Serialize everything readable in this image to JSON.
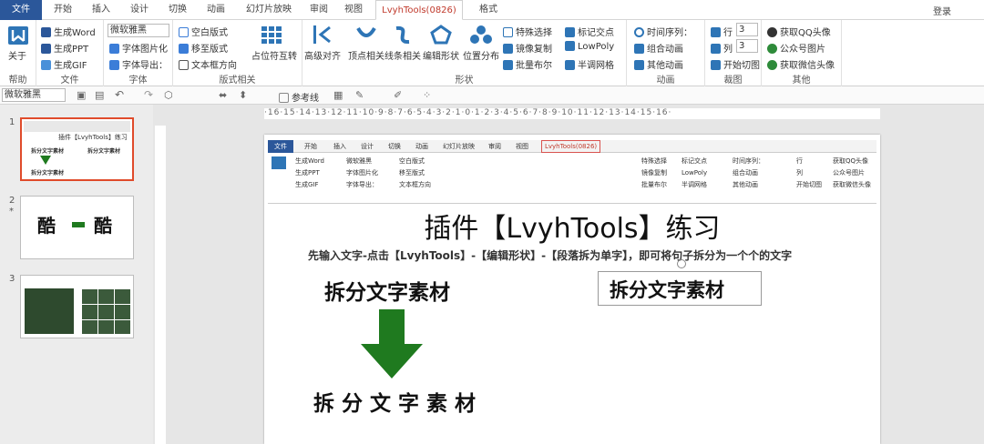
{
  "tabs": [
    "文件",
    "开始",
    "插入",
    "设计",
    "切换",
    "动画",
    "幻灯片放映",
    "审阅",
    "视图",
    "LvyhTools(0826)",
    "格式"
  ],
  "login": "登录",
  "ribbon": {
    "help": {
      "btn": "关于",
      "label": "帮助"
    },
    "file": {
      "items": [
        "生成Word",
        "生成PPT",
        "生成GIF"
      ],
      "label": "文件"
    },
    "font": {
      "combo": "微软雅黑",
      "items": [
        "字体图片化",
        "字体导出："
      ],
      "label": "字体"
    },
    "layout": {
      "items": [
        "空白版式",
        "移至版式",
        "文本框方向"
      ],
      "big": "占位符互转",
      "label": "版式相关"
    },
    "shape": {
      "bigs": [
        "高级对齐",
        "顶点相关",
        "线条相关",
        "编辑形状",
        "位置分布"
      ],
      "items": [
        "特殊选择",
        "镜像复制",
        "批量布尔",
        "标记交点",
        "LowPoly",
        "半调网格"
      ],
      "label": "形状"
    },
    "anim": {
      "items": [
        "时间序列：",
        "组合动画",
        "其他动画"
      ],
      "label": "动画"
    },
    "crop": {
      "row": "行",
      "col": "列",
      "rowval": "3",
      "colval": "3",
      "start": "开始切图",
      "label": "裁图"
    },
    "other": {
      "items": [
        "获取QQ头像",
        "公众号图片",
        "获取微信头像"
      ],
      "label": "其他"
    }
  },
  "toolbar2": {
    "font": "微软雅黑",
    "guides": "参考线"
  },
  "thumbs": [
    {
      "num": "1"
    },
    {
      "num": "2",
      "star": "*"
    },
    {
      "num": "3"
    }
  ],
  "ruler": "·16·15·14·13·12·11·10·9·8·7·6·5·4·3·2·1·0·1·2·3·4·5·6·7·8·9·10·11·12·13·14·15·16·",
  "slide": {
    "title": "插件【LvyhTools】练习",
    "subtitle": "先输入文字-点击【LvyhTools】-【编辑形状】-【段落拆为单字】，即可将句子拆分为一个个的文字",
    "text_left": "拆分文字素材",
    "text_right": "拆分文字素材",
    "text_bottom": "拆 分 文 字 素 材"
  }
}
